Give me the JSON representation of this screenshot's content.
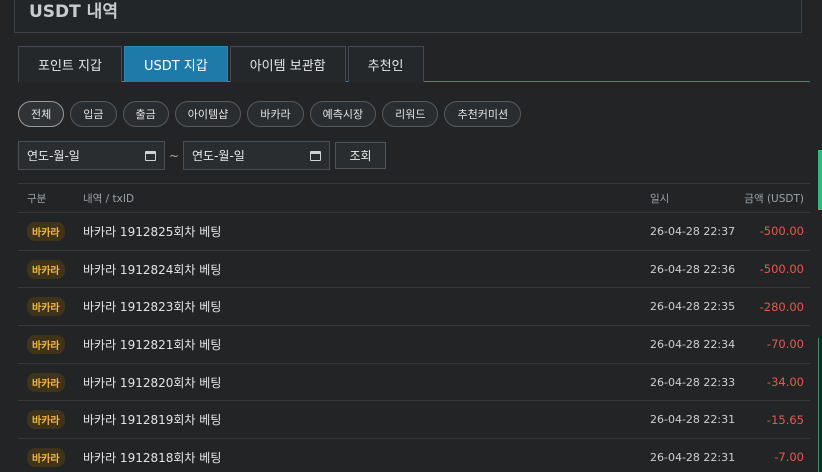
{
  "header": {
    "title": "USDT 내역"
  },
  "tabs": [
    {
      "label": "포인트 지갑",
      "active": false
    },
    {
      "label": "USDT 지갑",
      "active": true
    },
    {
      "label": "아이템 보관함",
      "active": false
    },
    {
      "label": "추천인",
      "active": false
    }
  ],
  "filters": {
    "chips": [
      "전체",
      "입금",
      "출금",
      "아이템샵",
      "바카라",
      "예측시장",
      "리워드",
      "추천커미션"
    ],
    "active_chip": "전체",
    "start_date_placeholder": "연도-월-일",
    "end_date_placeholder": "연도-월-일",
    "range_separator": "~",
    "search_label": "조회"
  },
  "table": {
    "headers": {
      "type": "구분",
      "desc": "내역 / txID",
      "date": "일시",
      "amount": "금액 (USDT)"
    },
    "rows": [
      {
        "type": "바카라",
        "desc": "바카라 1912825회차 베팅",
        "date": "26-04-28 22:37",
        "amount": "-500.00"
      },
      {
        "type": "바카라",
        "desc": "바카라 1912824회차 베팅",
        "date": "26-04-28 22:36",
        "amount": "-500.00"
      },
      {
        "type": "바카라",
        "desc": "바카라 1912823회차 베팅",
        "date": "26-04-28 22:35",
        "amount": "-280.00"
      },
      {
        "type": "바카라",
        "desc": "바카라 1912821회차 베팅",
        "date": "26-04-28 22:34",
        "amount": "-70.00"
      },
      {
        "type": "바카라",
        "desc": "바카라 1912820회차 베팅",
        "date": "26-04-28 22:33",
        "amount": "-34.00"
      },
      {
        "type": "바카라",
        "desc": "바카라 1912819회차 베팅",
        "date": "26-04-28 22:31",
        "amount": "-15.65"
      },
      {
        "type": "바카라",
        "desc": "바카라 1912818회차 베팅",
        "date": "26-04-28 22:31",
        "amount": "-7.00"
      }
    ]
  },
  "colors": {
    "accent": "#1e7aa8",
    "negative": "#e35b4f",
    "badge_text": "#f2b743",
    "background": "#222426"
  }
}
